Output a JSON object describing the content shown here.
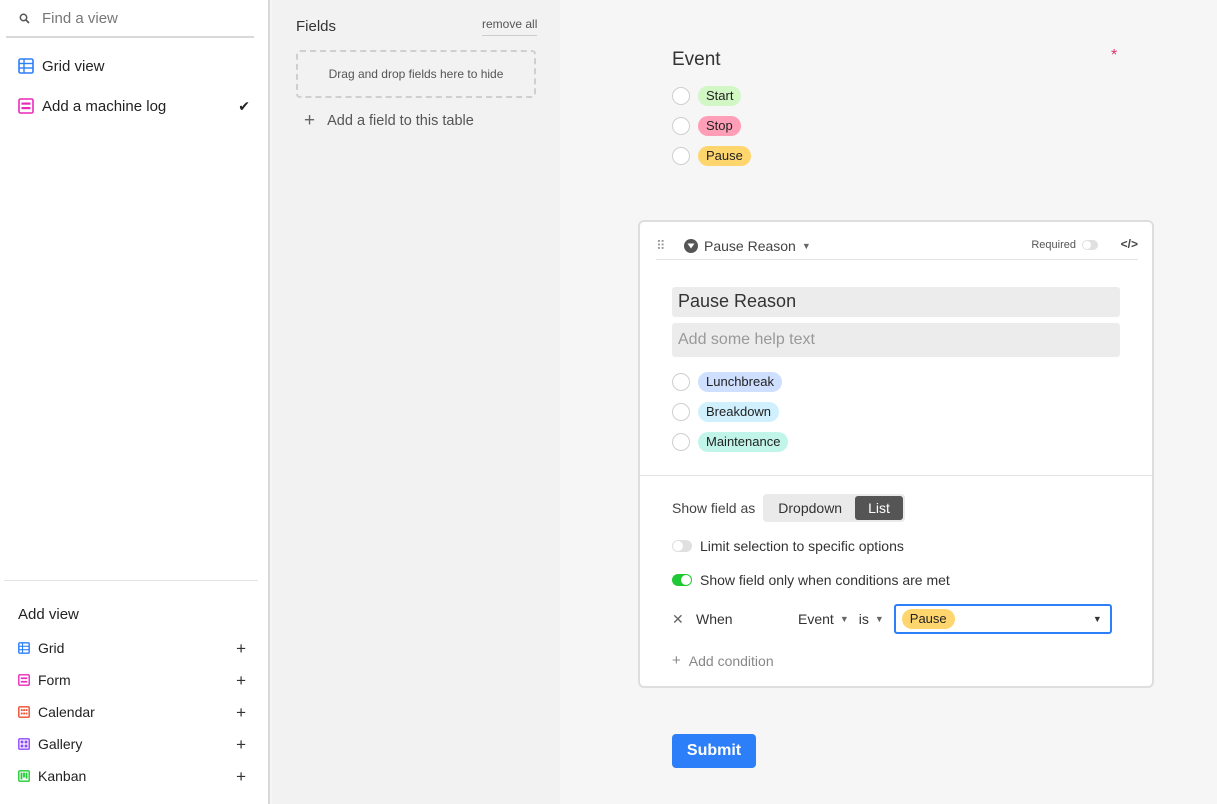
{
  "sidebar": {
    "search": {
      "placeholder": "Find a view"
    },
    "views": [
      {
        "label": "Grid view",
        "icon": "grid-icon",
        "color": "#2d7ff9",
        "selected": false
      },
      {
        "label": "Add a machine log",
        "icon": "form-icon",
        "color": "#e929ba",
        "selected": true
      }
    ],
    "add_view": {
      "title": "Add view",
      "items": [
        {
          "label": "Grid",
          "icon": "grid-icon",
          "color": "#2d7ff9"
        },
        {
          "label": "Form",
          "icon": "form-icon",
          "color": "#e929ba"
        },
        {
          "label": "Calendar",
          "icon": "calendar-icon",
          "color": "#f24a2a"
        },
        {
          "label": "Gallery",
          "icon": "gallery-icon",
          "color": "#8b46ff"
        },
        {
          "label": "Kanban",
          "icon": "kanban-icon",
          "color": "#20c933"
        }
      ]
    }
  },
  "fields_panel": {
    "title": "Fields",
    "remove_all": "remove all",
    "dropzone": "Drag and drop fields here to hide",
    "add_field": "Add a field to this table"
  },
  "form": {
    "event": {
      "title": "Event",
      "required_marker": "*",
      "options": [
        {
          "label": "Start",
          "color": "#d1f7c4"
        },
        {
          "label": "Stop",
          "color": "#ff9eb7"
        },
        {
          "label": "Pause",
          "color": "#ffd66e"
        }
      ]
    },
    "pause_card": {
      "field_type_label": "Pause Reason",
      "required_label": "Required",
      "name_value": "Pause Reason",
      "help_placeholder": "Add some help text",
      "options": [
        {
          "label": "Lunchbreak",
          "color": "#cfdfff"
        },
        {
          "label": "Breakdown",
          "color": "#d0f0fd"
        },
        {
          "label": "Maintenance",
          "color": "#c2f5e9"
        }
      ],
      "show_field_as": {
        "label": "Show field as",
        "options": [
          "Dropdown",
          "List"
        ],
        "selected": "List"
      },
      "limit_selection": {
        "label": "Limit selection to specific options",
        "on": false
      },
      "conditional": {
        "label": "Show field only when conditions are met",
        "on": true
      },
      "condition": {
        "when": "When",
        "field": "Event",
        "operator": "is",
        "value": "Pause",
        "value_color": "#ffd66e"
      },
      "add_condition": "Add condition"
    },
    "submit_label": "Submit"
  }
}
